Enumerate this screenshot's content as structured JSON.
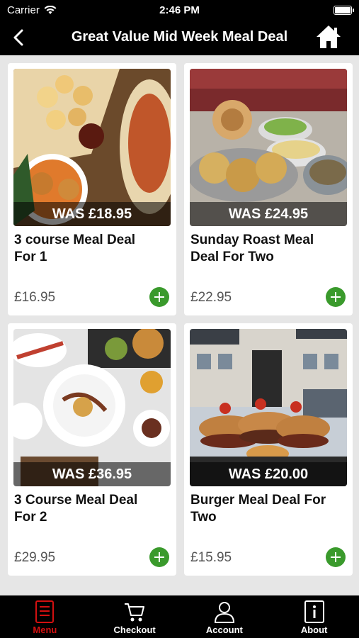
{
  "status": {
    "carrier": "Carrier",
    "time": "2:46 PM"
  },
  "header": {
    "title": "Great Value Mid Week Meal Deal",
    "back_icon": "chevron-left-icon",
    "home_icon": "home-icon"
  },
  "deals": [
    {
      "was": "WAS £18.95",
      "name": "3 course Meal Deal\nFor 1",
      "price": "£16.95"
    },
    {
      "was": "WAS £24.95",
      "name": "Sunday Roast Meal\nDeal  For Two",
      "price": "£22.95"
    },
    {
      "was": "WAS £36.95",
      "name": "3 Course Meal Deal\nFor 2",
      "price": "£29.95"
    },
    {
      "was": "WAS £20.00",
      "name": "Burger Meal Deal For\nTwo",
      "price": "£15.95"
    }
  ],
  "tabs": [
    {
      "label": "Menu",
      "icon": "menu-book-icon"
    },
    {
      "label": "Checkout",
      "icon": "cart-icon"
    },
    {
      "label": "Account",
      "icon": "user-icon"
    },
    {
      "label": "About",
      "icon": "info-icon"
    }
  ],
  "colors": {
    "accent": "#3a9a2c",
    "active_tab": "#d21010",
    "bar": "#000000"
  }
}
